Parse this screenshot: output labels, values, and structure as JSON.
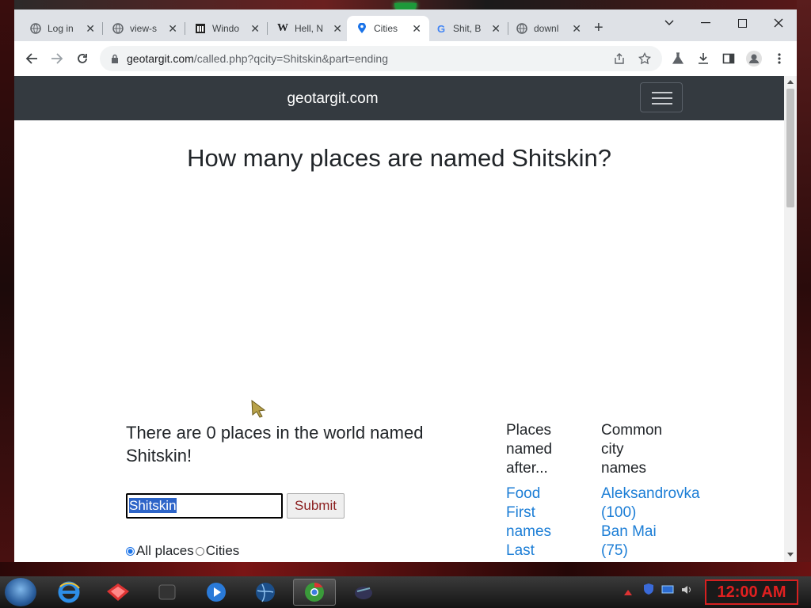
{
  "tabs": [
    {
      "title": "Log in",
      "icon": "globe-icon"
    },
    {
      "title": "view-s",
      "icon": "globe-icon"
    },
    {
      "title": "Windo",
      "icon": "museum-icon"
    },
    {
      "title": "Hell, N",
      "icon": "wikipedia-icon"
    },
    {
      "title": "Cities",
      "icon": "map-pin-icon",
      "active": true
    },
    {
      "title": "Shit, B",
      "icon": "google-icon"
    },
    {
      "title": "downl",
      "icon": "globe-icon"
    }
  ],
  "address": {
    "domain": "geotargit.com",
    "rest": "/called.php?qcity=Shitskin&part=ending"
  },
  "site": {
    "brand": "geotargit.com",
    "heading": "How many places are named Shitskin?",
    "result": "There are 0 places in the world named Shitskin!",
    "search_value": "Shitskin",
    "submit_label": "Submit",
    "radio_all": "All places",
    "radio_cities": "Cities",
    "col1_header_lines": [
      "Places",
      "named",
      "after..."
    ],
    "col1_links": [
      "Food",
      "First",
      "names",
      "Last"
    ],
    "col2_header_lines": [
      "Common",
      "city",
      "names"
    ],
    "col2_links": [
      "Aleksandrovka",
      "(100)",
      "Ban Mai",
      "(75)"
    ]
  },
  "taskbar": {
    "clock": "12:00 AM"
  },
  "colors": {
    "navbar": "#343a40",
    "link": "#1c7ed6",
    "clock": "#e02020"
  }
}
